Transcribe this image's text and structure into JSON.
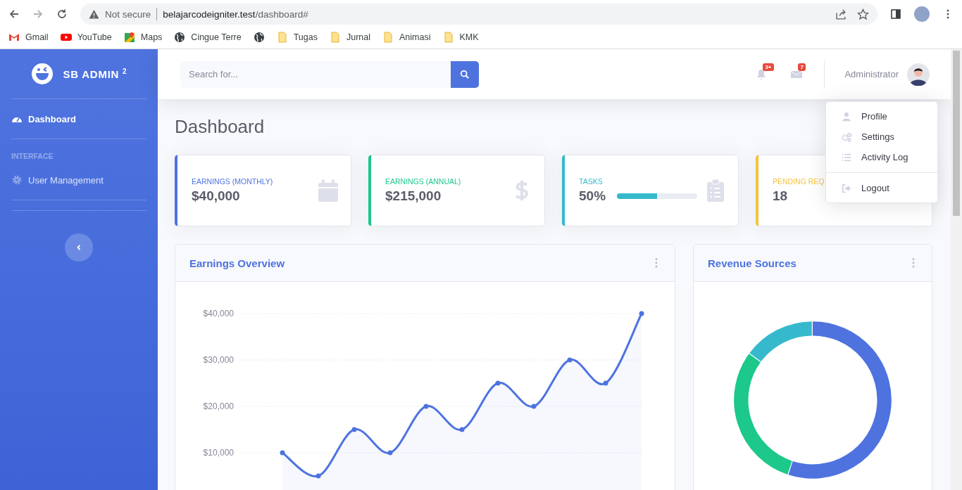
{
  "browser": {
    "security": "Not secure",
    "url_host": "belajarcodeigniter.test",
    "url_path": "/dashboard#"
  },
  "bookmarks": [
    {
      "kind": "gmail",
      "label": "Gmail"
    },
    {
      "kind": "youtube",
      "label": "YouTube"
    },
    {
      "kind": "maps",
      "label": "Maps"
    },
    {
      "kind": "globe",
      "label": "Cingue Terre"
    },
    {
      "kind": "globe"
    },
    {
      "kind": "folder",
      "label": "Tugas"
    },
    {
      "kind": "folder",
      "label": "Jurnal"
    },
    {
      "kind": "folder",
      "label": "Animasi"
    },
    {
      "kind": "folder",
      "label": "KMK"
    }
  ],
  "sidebar": {
    "brand": "SB ADMIN",
    "brand_sup": "2",
    "items": [
      {
        "kind": "nav",
        "label": "Dashboard",
        "selected": true
      },
      {
        "kind": "heading",
        "label": "INTERFACE"
      },
      {
        "kind": "nav",
        "label": "User Management",
        "selected": false
      }
    ]
  },
  "topbar": {
    "search_placeholder": "Search for...",
    "alerts_badge": "3+",
    "messages_badge": "7",
    "user_name": "Administrator"
  },
  "user_menu": [
    {
      "label": "Profile",
      "divider_before": false
    },
    {
      "label": "Settings",
      "divider_before": false
    },
    {
      "label": "Activity Log",
      "divider_before": false
    },
    {
      "label": "Logout",
      "divider_before": true
    }
  ],
  "page_title": "Dashboard",
  "cards": [
    {
      "kind": "value",
      "label": "EARNINGS (MONTHLY)",
      "value": "$40,000",
      "color": "#4e73df"
    },
    {
      "kind": "value",
      "label": "EARNINGS (ANNUAL)",
      "value": "$215,000",
      "color": "#1cc88a"
    },
    {
      "kind": "progress",
      "label": "TASKS",
      "value": "50%",
      "level": 0.5,
      "color": "#36b9cc"
    },
    {
      "kind": "value",
      "label": "PENDING REQ",
      "value": "18",
      "color": "#f6c23e"
    }
  ],
  "earnings_panel": {
    "title": "Earnings Overview",
    "chart_data": {
      "type": "area",
      "ylim": [
        0,
        40000
      ],
      "grid": true,
      "series": [
        {
          "color": "#4e73df",
          "values": [
            10000,
            5000,
            15000,
            10000,
            20000,
            15000,
            25000,
            20000,
            30000,
            25000,
            40000
          ]
        }
      ],
      "yticks": [
        {
          "value": 10000,
          "label": "$10,000"
        },
        {
          "value": 20000,
          "label": "$20,000"
        },
        {
          "value": 30000,
          "label": "$30,000"
        },
        {
          "value": 40000,
          "label": "$40,000"
        }
      ]
    }
  },
  "revenue_panel": {
    "title": "Revenue Sources"
  }
}
